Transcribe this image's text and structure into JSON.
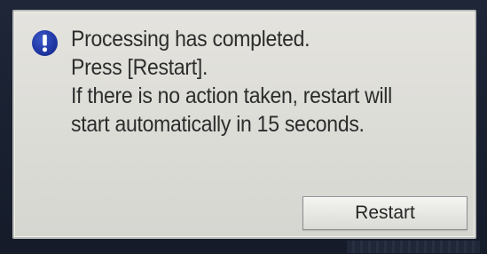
{
  "dialog": {
    "icon": "exclamation-info-icon",
    "icon_color": "#1f35a1",
    "message_lines": [
      "Processing has completed.",
      "Press [Restart].",
      "If there is no action taken, restart will",
      "start automatically in 15 seconds."
    ],
    "restart_label": "Restart"
  }
}
